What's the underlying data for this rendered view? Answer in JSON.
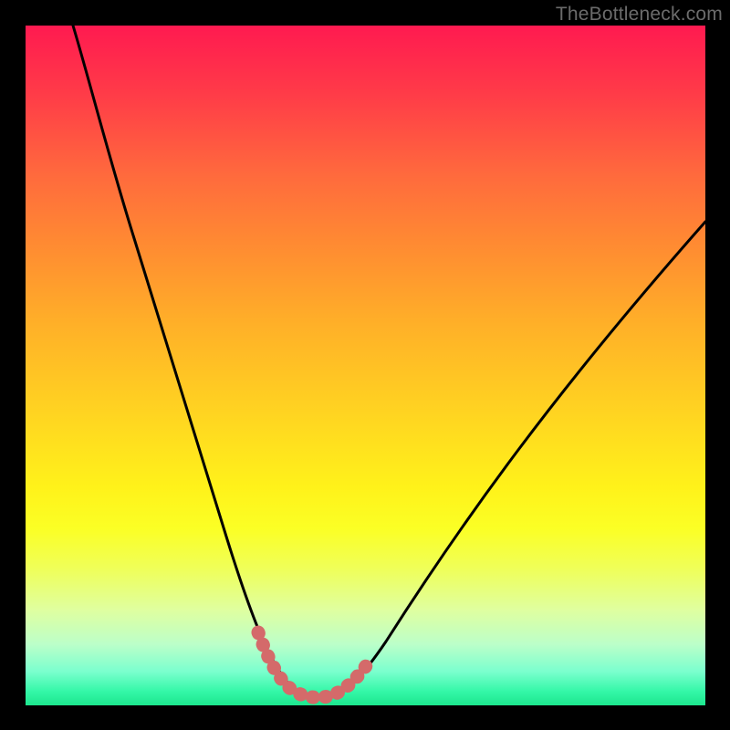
{
  "watermark": "TheBottleneck.com",
  "colors": {
    "background": "#000000",
    "curve": "#000000",
    "highlight": "#d46a6a",
    "gradient_top": "#ff1a50",
    "gradient_mid": "#fff21a",
    "gradient_bottom": "#1de68e"
  },
  "chart_data": {
    "type": "line",
    "title": "",
    "xlabel": "",
    "ylabel": "",
    "xlim": [
      0,
      100
    ],
    "ylim": [
      0,
      100
    ],
    "series": [
      {
        "name": "bottleneck-curve",
        "x": [
          7,
          10,
          14,
          18,
          22,
          26,
          30,
          33,
          35,
          37,
          38,
          40,
          42,
          44,
          46,
          48,
          51,
          55,
          60,
          66,
          72,
          78,
          85,
          92,
          100
        ],
        "y": [
          100,
          91,
          80,
          68,
          56,
          44,
          31,
          20,
          13,
          8,
          5,
          3,
          2,
          2,
          3,
          5,
          8,
          13,
          20,
          28,
          36,
          45,
          54,
          63,
          72
        ]
      },
      {
        "name": "highlight-segment",
        "x": [
          35,
          37,
          38,
          40,
          42,
          44,
          46,
          48,
          50
        ],
        "y": [
          11,
          7,
          5,
          3,
          2,
          2,
          3,
          5,
          8
        ]
      }
    ],
    "annotations": [
      {
        "text": "TheBottleneck.com",
        "role": "watermark"
      }
    ]
  }
}
